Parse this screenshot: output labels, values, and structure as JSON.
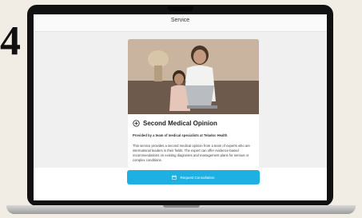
{
  "step_number": "4",
  "header": {
    "title": "Service"
  },
  "card": {
    "title": "Second Medical Opinion",
    "subtitle": "Provided by a team of medical specialists at Teladoc Health",
    "body": "This service provides a second medical opinion from a team of experts who are international leaders in their fields. The expert can offer evidence-based recommendations on existing diagnoses and management plans for serious or complex conditions."
  },
  "cta": {
    "label": "Request Consultation",
    "icon": "calendar-icon"
  },
  "colors": {
    "accent": "#1fb0e3",
    "background": "#f1ece4"
  }
}
